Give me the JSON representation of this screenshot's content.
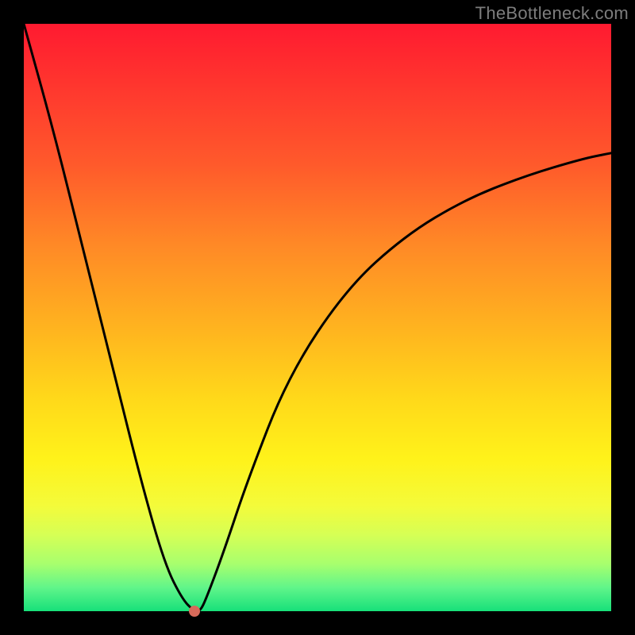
{
  "watermark": "TheBottleneck.com",
  "chart_data": {
    "type": "line",
    "title": "",
    "xlabel": "",
    "ylabel": "",
    "xlim": [
      0,
      100
    ],
    "ylim": [
      0,
      100
    ],
    "background_gradient": {
      "top": "#ff1a30",
      "bottom": "#17e07a"
    },
    "series": [
      {
        "name": "bottleneck-curve",
        "x": [
          0,
          5,
          10,
          15,
          20,
          24,
          27,
          29,
          30,
          31,
          34,
          38,
          45,
          55,
          65,
          75,
          85,
          95,
          100
        ],
        "y": [
          100,
          82,
          62,
          42,
          22,
          8,
          2,
          0,
          0,
          2,
          10,
          22,
          40,
          55,
          64,
          70,
          74,
          77,
          78
        ]
      }
    ],
    "annotations": [
      {
        "name": "min-point",
        "x": 29,
        "y": 0,
        "color": "#d66a5a"
      }
    ]
  }
}
